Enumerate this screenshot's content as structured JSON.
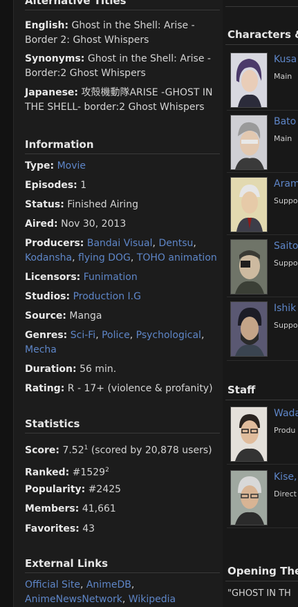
{
  "alt_titles": {
    "heading": "Alternative Titles",
    "english_label": "English:",
    "english_value": "Ghost in the Shell: Arise - Border 2: Ghost Whispers",
    "synonyms_label": "Synonyms:",
    "synonyms_value": "Ghost in the Shell: Arise - Border:2 Ghost Whispers",
    "japanese_label": "Japanese:",
    "japanese_value": "攻殻機動隊ARISE -GHOST IN THE SHELL- border:2 Ghost Whispers"
  },
  "information": {
    "heading": "Information",
    "type_label": "Type:",
    "type_value": "Movie",
    "episodes_label": "Episodes:",
    "episodes_value": "1",
    "status_label": "Status:",
    "status_value": "Finished Airing",
    "aired_label": "Aired:",
    "aired_value": "Nov 30, 2013",
    "producers_label": "Producers:",
    "producers": [
      "Bandai Visual",
      "Dentsu",
      "Kodansha",
      "flying DOG",
      "TOHO animation"
    ],
    "licensors_label": "Licensors:",
    "licensors_value": "Funimation",
    "studios_label": "Studios:",
    "studios_value": "Production I.G",
    "source_label": "Source:",
    "source_value": "Manga",
    "genres_label": "Genres:",
    "genres": [
      "Sci-Fi",
      "Police",
      "Psychological",
      "Mecha"
    ],
    "duration_label": "Duration:",
    "duration_value": "56 min.",
    "rating_label": "Rating:",
    "rating_value": "R - 17+ (violence & profanity)"
  },
  "statistics": {
    "heading": "Statistics",
    "score_label": "Score:",
    "score_value": "7.52",
    "score_sup": "1",
    "score_note": "(scored by 20,878 users)",
    "ranked_label": "Ranked:",
    "ranked_value": "#1529",
    "ranked_sup": "2",
    "popularity_label": "Popularity:",
    "popularity_value": "#2425",
    "members_label": "Members:",
    "members_value": "41,661",
    "favorites_label": "Favorites:",
    "favorites_value": "43"
  },
  "external_links": {
    "heading": "External Links",
    "links": [
      "Official Site",
      "AnimeDB",
      "AnimeNewsNetwork",
      "Wikipedia"
    ]
  },
  "characters": {
    "heading": "Characters &",
    "items": [
      {
        "name": "Kusa",
        "role": "Main"
      },
      {
        "name": "Bato",
        "role": "Main"
      },
      {
        "name": "Aram",
        "role": "Suppo"
      },
      {
        "name": "Saito",
        "role": "Suppo"
      },
      {
        "name": "Ishik",
        "role": "Suppo"
      }
    ]
  },
  "staff": {
    "heading": "Staff",
    "items": [
      {
        "name": "Wada",
        "role": "Produ"
      },
      {
        "name": "Kise,",
        "role": "Direct"
      }
    ]
  },
  "opening": {
    "heading": "Opening The",
    "text": "\"GHOST IN TH"
  },
  "colors": {
    "link": "#5e86c8",
    "background": "#1c1c1c"
  }
}
